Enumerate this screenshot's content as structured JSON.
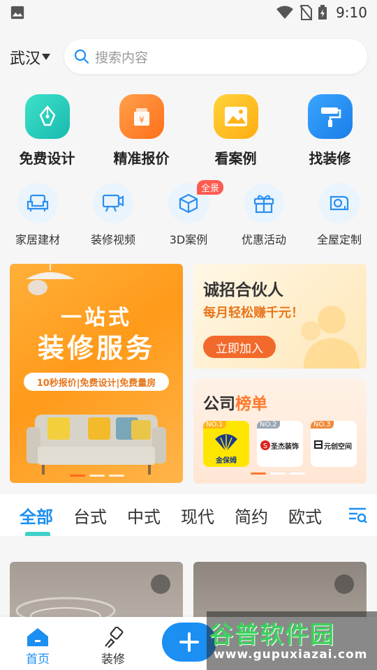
{
  "status_bar": {
    "time": "9:10"
  },
  "header": {
    "city": "武汉",
    "search_placeholder": "搜索内容"
  },
  "main_icons": [
    {
      "label": "免费设计",
      "icon": "pen-nib-icon",
      "color": "#2dd4bf"
    },
    {
      "label": "精准报价",
      "icon": "yen-box-icon",
      "color": "#ff8a2b"
    },
    {
      "label": "看案例",
      "icon": "picture-icon",
      "color": "#ffc21a"
    },
    {
      "label": "找装修",
      "icon": "paint-roller-icon",
      "color": "#2a8ff0"
    }
  ],
  "secondary_icons": [
    {
      "label": "家居建材",
      "icon": "sofa-icon"
    },
    {
      "label": "装修视频",
      "icon": "video-camera-icon"
    },
    {
      "label": "3D案例",
      "icon": "cube-icon",
      "badge": "全景"
    },
    {
      "label": "优惠活动",
      "icon": "gift-icon"
    },
    {
      "label": "全屋定制",
      "icon": "measuring-tape-icon"
    }
  ],
  "banner_main": {
    "line1": "一站式",
    "line2": "装修服务",
    "pill": "10秒报价|免费设计|免费量房"
  },
  "banner_partner": {
    "title": "诚招合伙人",
    "subtitle": "每月轻松赚千元！",
    "button": "立即加入"
  },
  "banner_rank": {
    "title_a": "公司",
    "title_b": "榜单",
    "ranks": [
      {
        "no": "NO.1",
        "name": "金保姆",
        "no_color": "#ffb21a"
      },
      {
        "no": "NO.2",
        "name": "圣杰装饰",
        "no_color": "#9aa6b5"
      },
      {
        "no": "NO.3",
        "name": "元创空间",
        "no_color": "#f08a3a"
      }
    ]
  },
  "tabs": [
    "全部",
    "台式",
    "中式",
    "现代",
    "简约",
    "欧式"
  ],
  "active_tab": "全部",
  "bottom_nav": [
    {
      "label": "首页",
      "icon": "home-icon",
      "active": true
    },
    {
      "label": "装修",
      "icon": "brush-icon",
      "active": false
    }
  ],
  "watermark": {
    "title": "谷普软件园",
    "url": "www.gupuxiazai.com"
  },
  "colors": {
    "accent": "#1c8ff2",
    "orange": "#ff7a2b"
  }
}
